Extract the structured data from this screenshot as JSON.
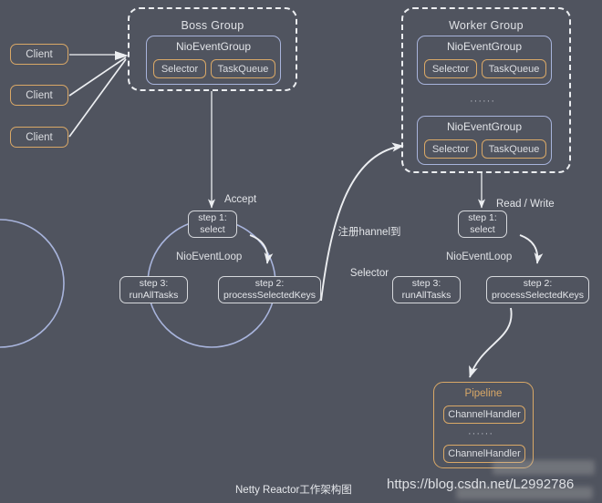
{
  "diagram": {
    "caption": "Netty Reactor工作架构图",
    "watermark": "https://blog.csdn.net/L2992786",
    "background_color": "#50545f",
    "accent_orange": "#d9a867",
    "accent_blue": "#a8b4dc",
    "accent_white": "#eceef1"
  },
  "clients": [
    {
      "label": "Client"
    },
    {
      "label": "Client"
    },
    {
      "label": "Client"
    }
  ],
  "boss_group": {
    "title": "Boss Group",
    "event_groups": [
      {
        "title": "NioEventGroup",
        "selector": "Selector",
        "task_queue": "TaskQueue"
      }
    ]
  },
  "worker_group": {
    "title": "Worker  Group",
    "ellipsis": "······",
    "event_groups": [
      {
        "title": "NioEventGroup",
        "selector": "Selector",
        "task_queue": "TaskQueue"
      },
      {
        "title": "NioEventGroup",
        "selector": "Selector",
        "task_queue": "TaskQueue"
      }
    ]
  },
  "boss_loop": {
    "name": "NioEventLoop",
    "incoming_label": "Accept",
    "steps": [
      {
        "line1": "step 1:",
        "line2": "select"
      },
      {
        "line1": "step 2:",
        "line2": "processSelectedKeys"
      },
      {
        "line1": "step 3:",
        "line2": "runAllTasks"
      }
    ]
  },
  "worker_loop": {
    "name": "NioEventLoop",
    "incoming_label": "Read / Write",
    "steps": [
      {
        "line1": "step 1:",
        "line2": "select"
      },
      {
        "line1": "step 2:",
        "line2": "processSelectedKeys"
      },
      {
        "line1": "step 3:",
        "line2": "runAllTasks"
      }
    ]
  },
  "register_arrow": {
    "line1": "注册hannel到",
    "line2": "Selector"
  },
  "pipeline": {
    "title": "Pipeline",
    "ellipsis": "······",
    "handlers": [
      {
        "label": "ChannelHandler"
      },
      {
        "label": "ChannelHandler"
      }
    ]
  }
}
